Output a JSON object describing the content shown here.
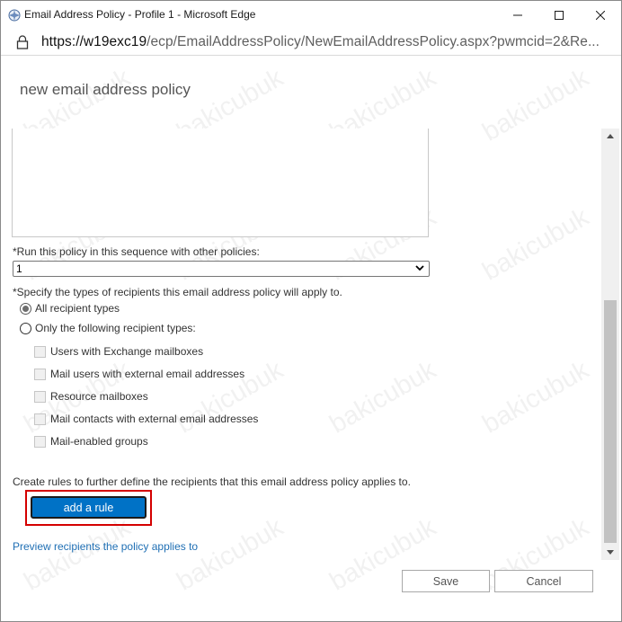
{
  "window": {
    "title": "Email Address Policy - Profile 1 - Microsoft Edge",
    "controls": {
      "minimize_icon": "minimize-icon",
      "maximize_icon": "maximize-icon",
      "close_icon": "close-icon"
    }
  },
  "address_bar": {
    "url_domain": "https://w19exc19",
    "url_path": "/ecp/EmailAddressPolicy/NewEmailAddressPolicy.aspx?pwmcid=2&Re..."
  },
  "page": {
    "title": "new email address policy"
  },
  "form": {
    "sequence_label": "*Run this policy in this sequence with other policies:",
    "sequence_value": "1",
    "types_label": "*Specify the types of recipients this email address policy will apply to.",
    "radio_all": {
      "label": "All recipient types",
      "checked": true
    },
    "radio_only": {
      "label": "Only the following recipient types:",
      "checked": false
    },
    "recipient_types": [
      {
        "label": "Users with Exchange mailboxes",
        "checked": false,
        "enabled": false
      },
      {
        "label": "Mail users with external email addresses",
        "checked": false,
        "enabled": false
      },
      {
        "label": "Resource mailboxes",
        "checked": false,
        "enabled": false
      },
      {
        "label": "Mail contacts with external email addresses",
        "checked": false,
        "enabled": false
      },
      {
        "label": "Mail-enabled groups",
        "checked": false,
        "enabled": false
      }
    ],
    "rules_label": "Create rules to further define the recipients that this email address policy applies to.",
    "add_rule_label": "add a rule",
    "preview_link": "Preview recipients the policy applies to"
  },
  "footer": {
    "save_label": "Save",
    "cancel_label": "Cancel"
  },
  "watermark": "bakicubuk",
  "colors": {
    "accent_button": "#0072c6",
    "highlight_border": "#d40000",
    "link": "#1f6fb4"
  }
}
